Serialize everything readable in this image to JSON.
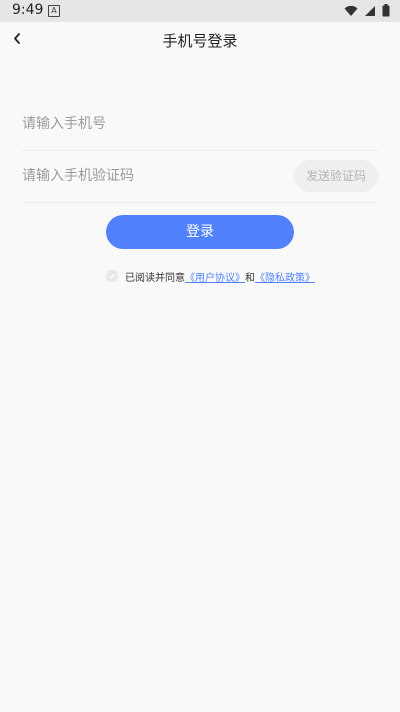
{
  "status_bar": {
    "time": "9:49",
    "icons": [
      "a-notification-icon",
      "wifi-icon",
      "signal-icon",
      "battery-icon"
    ]
  },
  "header": {
    "title": "手机号登录",
    "back_icon": "chevron-left-icon"
  },
  "form": {
    "phone_placeholder": "请输入手机号",
    "phone_value": "",
    "code_placeholder": "请输入手机验证码",
    "code_value": "",
    "send_code_label": "发送验证码",
    "login_label": "登录"
  },
  "agreement": {
    "prefix": "已阅读并同意",
    "user_agreement": "《用户协议》",
    "and": "和",
    "privacy_policy": "《隐私政策》",
    "checked": false
  },
  "colors": {
    "accent": "#5282fb",
    "background": "#f9f9f9",
    "placeholder": "#9a9a9a"
  }
}
